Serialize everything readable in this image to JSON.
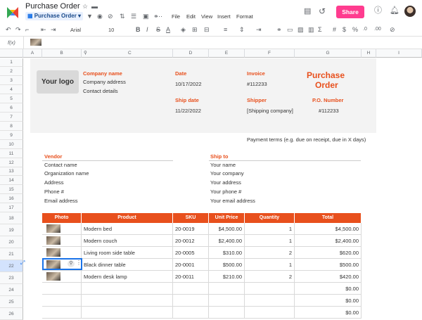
{
  "app": {
    "doc_title": "Purchase Order",
    "doc_chip": "Purchase Order",
    "menus": [
      "File",
      "Edit",
      "View",
      "Insert",
      "Format"
    ],
    "share_label": "Share",
    "brand_color": "#e8501d",
    "share_color": "#ff3c8f"
  },
  "toolbar": {
    "font": "Arial",
    "size": "10",
    "fx": "f(x)"
  },
  "columns": [
    "A",
    "B",
    "C",
    "D",
    "E",
    "F",
    "G",
    "H",
    "I"
  ],
  "rows": [
    "1",
    "2",
    "3",
    "4",
    "5",
    "6",
    "7",
    "8",
    "9",
    "10",
    "11",
    "12",
    "13",
    "14",
    "15",
    "16",
    "17",
    "18",
    "19",
    "20",
    "21",
    "22",
    "23",
    "24",
    "25",
    "26"
  ],
  "invoice": {
    "logo": "Your logo",
    "company_name": "Company name",
    "company_address": "Company address",
    "contact_details": "Contact details",
    "date_label": "Date",
    "date_value": "10/17/2022",
    "invoice_label": "Invoice",
    "invoice_value": "#112233",
    "po_title_1": "Purchase",
    "po_title_2": "Order",
    "ship_date_label": "Ship date",
    "ship_date_value": "11/22/2022",
    "shipper_label": "Shipper",
    "shipper_value": "[Shipping company]",
    "po_number_label": "P.O. Number",
    "po_number_value": "#112233",
    "payment_terms": "Payment terms (e.g. due on receipt, due in X days)"
  },
  "vendor": {
    "label": "Vendor",
    "lines": [
      "Contact name",
      "Organization name",
      "Address",
      "Phone #",
      "Email address"
    ]
  },
  "ship_to": {
    "label": "Ship to",
    "lines": [
      "Your name",
      "Your company",
      "Your address",
      "Your phone #",
      "Your email address"
    ]
  },
  "table": {
    "headers": [
      "Photo",
      "Product",
      "SKU",
      "Unit Price",
      "Quantity",
      "Total"
    ],
    "rows": [
      {
        "product": "Modern bed",
        "sku": "20-0019",
        "price": "$4,500.00",
        "qty": "1",
        "total": "$4,500.00"
      },
      {
        "product": "Modern couch",
        "sku": "20-0012",
        "price": "$2,400.00",
        "qty": "1",
        "total": "$2,400.00"
      },
      {
        "product": "Living room side table",
        "sku": "20-0005",
        "price": "$310.00",
        "qty": "2",
        "total": "$620.00"
      },
      {
        "product": "Black dinner table",
        "sku": "20-0001",
        "price": "$500.00",
        "qty": "1",
        "total": "$500.00"
      },
      {
        "product": "Modern desk lamp",
        "sku": "20-0011",
        "price": "$210.00",
        "qty": "2",
        "total": "$420.00"
      },
      {
        "product": "",
        "sku": "",
        "price": "",
        "qty": "",
        "total": "$0.00"
      },
      {
        "product": "",
        "sku": "",
        "price": "",
        "qty": "",
        "total": "$0.00"
      },
      {
        "product": "",
        "sku": "",
        "price": "",
        "qty": "",
        "total": "$0.00"
      }
    ]
  }
}
